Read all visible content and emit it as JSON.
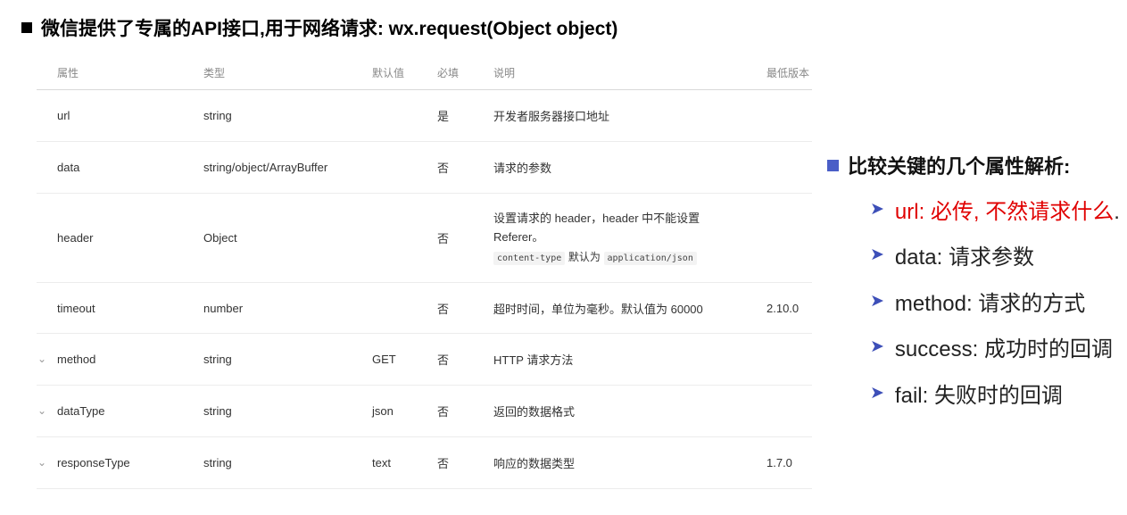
{
  "title": "微信提供了专属的API接口,用于网络请求: wx.request(Object object)",
  "table": {
    "headers": [
      "属性",
      "类型",
      "默认值",
      "必填",
      "说明",
      "最低版本"
    ],
    "rows": [
      {
        "name": "url",
        "type": "string",
        "default": "",
        "required": "是",
        "desc": "开发者服务器接口地址",
        "version": "",
        "expandable": false
      },
      {
        "name": "data",
        "type": "string/object/ArrayBuffer",
        "default": "",
        "required": "否",
        "desc": "请求的参数",
        "version": "",
        "expandable": false
      },
      {
        "name": "header",
        "type": "Object",
        "default": "",
        "required": "否",
        "desc": "设置请求的 header，header 中不能设置 Referer。",
        "desc_code_1": "content-type",
        "desc_mid": "默认为",
        "desc_code_2": "application/json",
        "version": "",
        "expandable": false
      },
      {
        "name": "timeout",
        "type": "number",
        "default": "",
        "required": "否",
        "desc": "超时时间，单位为毫秒。默认值为 60000",
        "version": "2.10.0",
        "expandable": false
      },
      {
        "name": "method",
        "type": "string",
        "default": "GET",
        "required": "否",
        "desc": "HTTP 请求方法",
        "version": "",
        "expandable": true
      },
      {
        "name": "dataType",
        "type": "string",
        "default": "json",
        "required": "否",
        "desc": "返回的数据格式",
        "version": "",
        "expandable": true
      },
      {
        "name": "responseType",
        "type": "string",
        "default": "text",
        "required": "否",
        "desc": "响应的数据类型",
        "version": "1.7.0",
        "expandable": true
      }
    ]
  },
  "aside": {
    "heading": "比较关键的几个属性解析:",
    "items": [
      {
        "text": "url: 必传, 不然请求什么",
        "suffix": ".",
        "highlight": true
      },
      {
        "text": "data: 请求参数",
        "suffix": "",
        "highlight": false
      },
      {
        "text": "method: 请求的方式",
        "suffix": "",
        "highlight": false
      },
      {
        "text": "success: 成功时的回调",
        "suffix": "",
        "highlight": false
      },
      {
        "text": "fail: 失败时的回调",
        "suffix": "",
        "highlight": false
      }
    ]
  },
  "colors": {
    "bullet_blue": "#4a5ec7",
    "arrow_blue": "#3d4fb8",
    "highlight_red": "#e00000"
  },
  "icons": {
    "expand": "chevron-down-icon",
    "arrow": "arrow-right-icon"
  }
}
